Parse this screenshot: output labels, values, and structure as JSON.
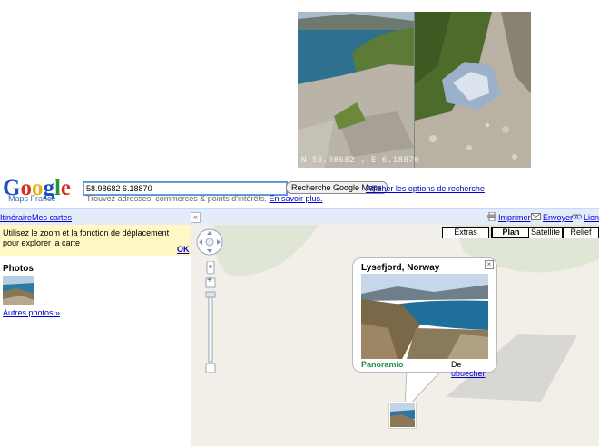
{
  "photo_strip": {
    "coords": "N 58.98682 , E 6.18870"
  },
  "header": {
    "logo_text": "Google",
    "logo_sub": "Maps France",
    "search_value": "58.98682 6.18870",
    "search_button": "Recherche Google Maps",
    "search_options": "Afficher les options de recherche",
    "hint": "Trouvez adresses, commerces & points d'intérêts.",
    "hint_link": "En savoir plus."
  },
  "topbar": {
    "itinerary": "Itinéraire",
    "my_maps": "Mes cartes",
    "collapse": "«",
    "print": "Imprimer",
    "send": "Envoyer",
    "link": "Lien"
  },
  "left_panel": {
    "notice": "Utilisez le zoom et la fonction de déplacement pour explorer la carte",
    "ok": "OK",
    "photos_title": "Photos",
    "more_photos": "Autres photos »"
  },
  "map": {
    "buttons": {
      "extras": "Extras",
      "plan": "Plan",
      "satellite": "Satellite",
      "relief": "Relief"
    },
    "zoom_in": "+",
    "zoom_out": "−"
  },
  "popup": {
    "title": "Lysefjord, Norway",
    "close": "×",
    "panoramio": "Panoramio",
    "credit_prefix": "De ",
    "credit_user": "ubuecher"
  },
  "colors": {
    "link": "#0000cc",
    "bar": "#e5ecf9",
    "notice": "#fff8c4",
    "map_bg": "#f2efe9",
    "panoramio": "#1e8c53"
  }
}
